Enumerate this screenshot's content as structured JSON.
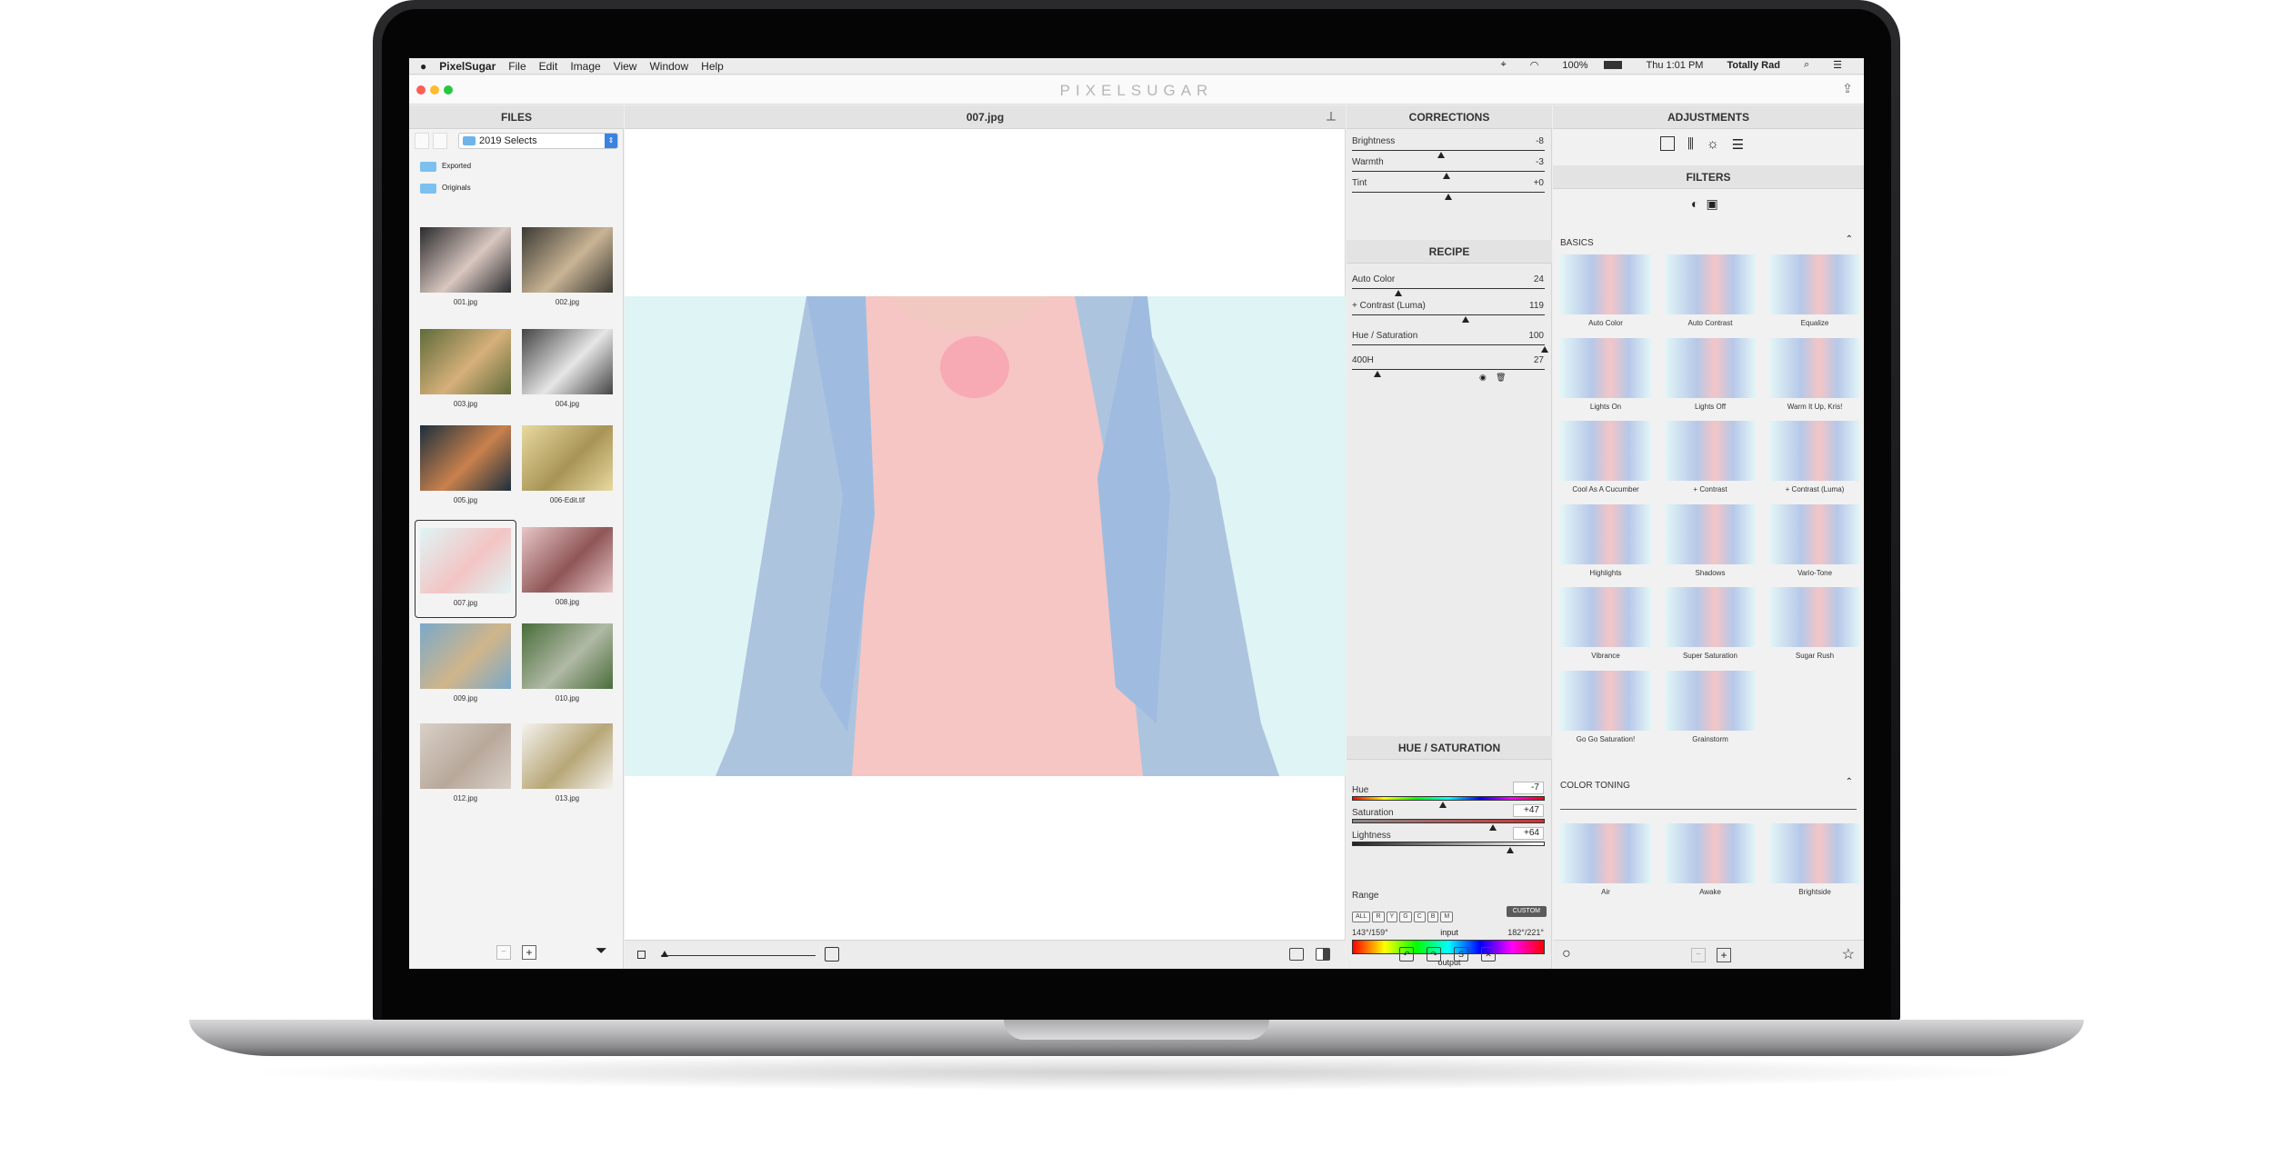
{
  "menubar": {
    "apple": "",
    "app_name": "PixelSugar",
    "menus": [
      "File",
      "Edit",
      "Image",
      "View",
      "Window",
      "Help"
    ],
    "battery": "100%",
    "clock": "Thu 1:01 PM",
    "user": "Totally Rad"
  },
  "window": {
    "logo": "PIXELSUGAR"
  },
  "files": {
    "header": "FILES",
    "folder": "2019 Selects",
    "subfolders": [
      "Exported",
      "Originals"
    ],
    "thumbs": [
      {
        "name": "001.jpg",
        "c1": "#2b2b2e",
        "c2": "#d9c7c0"
      },
      {
        "name": "002.jpg",
        "c1": "#3c3a33",
        "c2": "#c9b495"
      },
      {
        "name": "003.jpg",
        "c1": "#5f6b3a",
        "c2": "#d6b07a"
      },
      {
        "name": "004.jpg",
        "c1": "#444",
        "c2": "#e6e6e6"
      },
      {
        "name": "005.jpg",
        "c1": "#1d2f3d",
        "c2": "#c9814c"
      },
      {
        "name": "006-Edit.tif",
        "c1": "#e8d9a0",
        "c2": "#a89455"
      },
      {
        "name": "007.jpg",
        "c1": "#dff4f4",
        "c2": "#f3c4c4"
      },
      {
        "name": "008.jpg",
        "c1": "#e7c6c8",
        "c2": "#8f5656"
      },
      {
        "name": "009.jpg",
        "c1": "#7aa9c9",
        "c2": "#d0b58a"
      },
      {
        "name": "010.jpg",
        "c1": "#4a6d3a",
        "c2": "#b0b9a5"
      },
      {
        "name": "012.jpg",
        "c1": "#d8d0c8",
        "c2": "#b8a89a"
      },
      {
        "name": "013.jpg",
        "c1": "#f4f2ef",
        "c2": "#b7a777"
      }
    ]
  },
  "viewer": {
    "title": "007.jpg"
  },
  "corrections": {
    "header": "CORRECTIONS",
    "sliders": [
      {
        "label": "Brightness",
        "value": "-8",
        "pos": 0.46
      },
      {
        "label": "Warmth",
        "value": "-3",
        "pos": 0.49
      },
      {
        "label": "Tint",
        "value": "+0",
        "pos": 0.5
      }
    ]
  },
  "recipe": {
    "header": "RECIPE",
    "items": [
      {
        "label": "Auto Color",
        "value": "24",
        "pos": 0.24
      },
      {
        "label": "+ Contrast (Luma)",
        "value": "119",
        "pos": 0.59
      },
      {
        "label": "Hue / Saturation",
        "value": "100",
        "pos": 1.0
      },
      {
        "label": "400H",
        "value": "27",
        "pos": 0.13
      }
    ]
  },
  "huesat": {
    "header": "HUE / SATURATION",
    "hue": {
      "label": "Hue",
      "value": "-7",
      "pos": 0.47
    },
    "saturation": {
      "label": "Saturation",
      "value": "+47",
      "pos": 0.73
    },
    "lightness": {
      "label": "Lightness",
      "value": "+64",
      "pos": 0.82
    },
    "range_label": "Range",
    "range_buttons": [
      "ALL",
      "R",
      "Y",
      "G",
      "C",
      "B",
      "M"
    ],
    "range_custom": "CUSTOM",
    "in_left": "143°/159°",
    "in_mid": "input",
    "in_right": "182°/221°",
    "output": "output"
  },
  "adjustments": {
    "header": "ADJUSTMENTS",
    "filters_header": "FILTERS",
    "basics": "BASICS",
    "filters": [
      "Auto Color",
      "Auto Contrast",
      "Equalize",
      "Lights On",
      "Lights Off",
      "Warm It Up, Kris!",
      "Cool As A Cucumber",
      "+ Contrast",
      "+ Contrast (Luma)",
      "Highlights",
      "Shadows",
      "Vario-Tone",
      "Vibrance",
      "Super Saturation",
      "Sugar Rush",
      "Go Go Saturation!",
      "Grainstorm"
    ],
    "color_toning": "COLOR TONING",
    "toning": [
      "Air",
      "Awake",
      "Brightside"
    ]
  },
  "colors": {
    "accent": "#3b82e0",
    "custom_btn": "#5b5b5b"
  }
}
